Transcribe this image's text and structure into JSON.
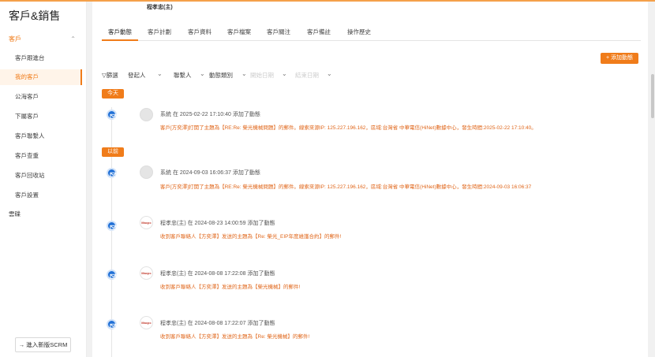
{
  "sidebar": {
    "brand": "客戶&銷售",
    "group_label": "客戶",
    "items": [
      {
        "label": "客戶跟進台"
      },
      {
        "label": "我的客戶",
        "active": true
      },
      {
        "label": "公海客戶"
      },
      {
        "label": "下屬客戶"
      },
      {
        "label": "客戶聯繫人"
      },
      {
        "label": "客戶查重"
      },
      {
        "label": "客戶回收站"
      },
      {
        "label": "客戶設置"
      }
    ],
    "extra": "雲碟",
    "new_version_btn": "→ 進入新版SCRM"
  },
  "header": {
    "owner": "程孝忠(主)"
  },
  "tabs": [
    "客戶動態",
    "客戶計劃",
    "客戶資料",
    "客戶檔案",
    "客戶關注",
    "客戶備註",
    "操作歷史"
  ],
  "add_button": "+ 添加動態",
  "filters": {
    "label": "▽篩選",
    "items": [
      "發起人",
      "聯繫人",
      "動態類別"
    ],
    "disabled": [
      "開始日期",
      "結束日期"
    ]
  },
  "sections": {
    "today": "今天",
    "earlier": "以前"
  },
  "entries": [
    {
      "meta": "系統 在 2025-02-22 17:10:40 添加了動態",
      "body": "客戶[方奕澤]打開了主題為【RE:Re: 榮光機械問題】的郵件。線索來源IP: 125.227.196.162，區域:台灣省 中華電信(HiNet)數據中心，發生時間:2025-02-22 17:10:40。"
    },
    {
      "meta": "系統 在 2024-09-03 16:06:37 添加了動態",
      "body": "客戶[方奕澤]打開了主題為【RE:Re: 榮光機械問題】的郵件。線索來源IP: 125.227.196.162，區域:台灣省 中華電信(HiNet)數據中心，發生時間:2024-09-03 16:06:37"
    },
    {
      "meta": "程孝忠(主) 在 2024-08-23 14:00:59 添加了動態",
      "body": "收到客戶聯絡人【方奕澤】发送的主題為【Re: 榮光_EIP年度維護合約】的郵件!"
    },
    {
      "meta": "程孝忠(主) 在 2024-08-08 17:22:08 添加了動態",
      "body": "收到客戶聯絡人【方奕澤】发送的主題為【榮光機械】的郵件!"
    },
    {
      "meta": "程孝忠(主) 在 2024-08-08 17:22:07 添加了動態",
      "body": "收到客戶聯絡人【方奕澤】发送的主題為【Re: 榮光機械】的郵件!"
    }
  ],
  "logo_text": "Macpc",
  "colors": {
    "accent": "#f07c1a",
    "node": "#1f6fd6"
  }
}
